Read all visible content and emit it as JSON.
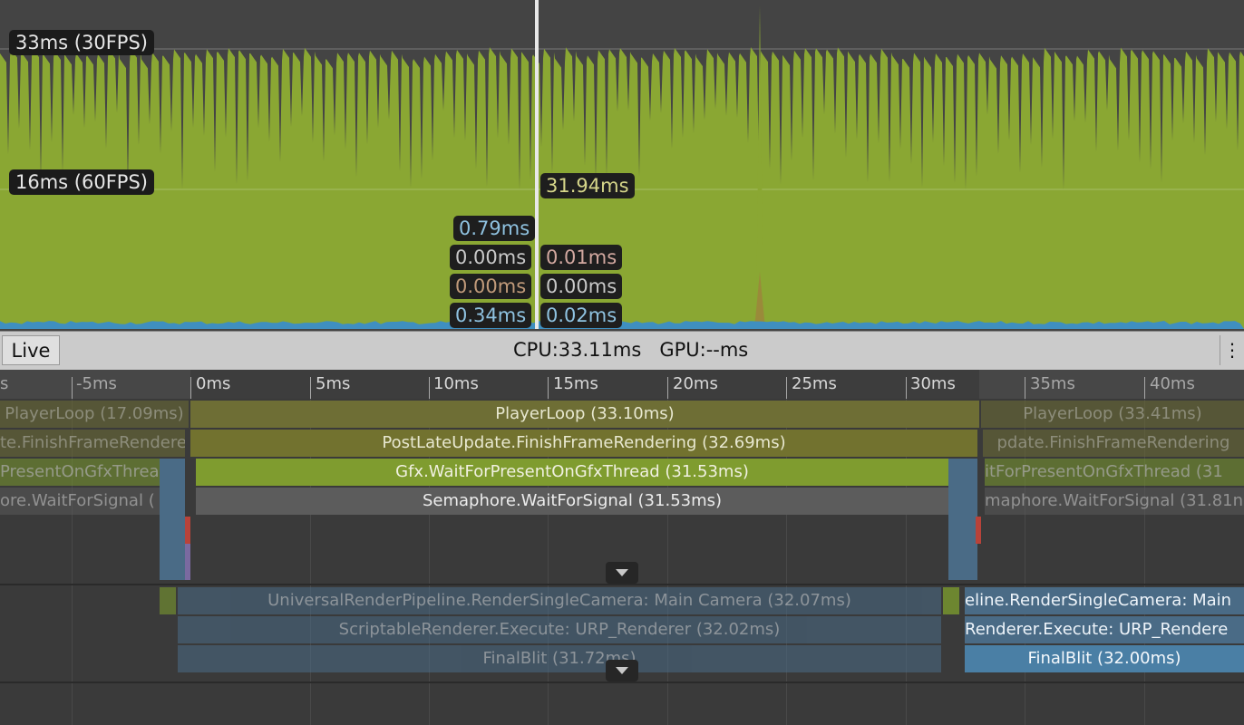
{
  "colors": {
    "cpu_green": "#8aa733",
    "render_blue": "#4a6b86",
    "playerloop_olive": "#6e6e35",
    "semaphore_gray": "#5a5a5a",
    "blue_line": "#3f8fc0"
  },
  "chart": {
    "ref_labels": [
      "33ms (30FPS)",
      "16ms (60FPS)"
    ],
    "selected_value": "31.94ms",
    "breakdown_left": [
      "0.79ms",
      "0.00ms",
      "0.00ms",
      "0.34ms"
    ],
    "breakdown_right": [
      "0.01ms",
      "0.00ms",
      "0.02ms"
    ]
  },
  "status": {
    "live_label": "Live",
    "cpu_gpu": "CPU:33.11ms   GPU:--ms",
    "menu_glyph": "⋮"
  },
  "ruler": {
    "ticks": [
      "s",
      "-5ms",
      "0ms",
      "5ms",
      "10ms",
      "15ms",
      "20ms",
      "25ms",
      "30ms",
      "35ms",
      "40ms"
    ]
  },
  "timeline": {
    "main": [
      {
        "label": "PlayerLoop (17.09ms)"
      },
      {
        "label": "PlayerLoop (33.10ms)"
      },
      {
        "label": "PlayerLoop (33.41ms)"
      },
      {
        "label": "te.FinishFrameRendere"
      },
      {
        "label": "PostLateUpdate.FinishFrameRendering (32.69ms)"
      },
      {
        "label": "pdate.FinishFrameRendering"
      },
      {
        "label": "PresentOnGfxThrea"
      },
      {
        "label": "Gfx.WaitForPresentOnGfxThread (31.53ms)"
      },
      {
        "label": "itForPresentOnGfxThread (31"
      },
      {
        "label": "ore.WaitForSignal ("
      },
      {
        "label": "Semaphore.WaitForSignal (31.53ms)"
      },
      {
        "label": "maphore.WaitForSignal (31.81n"
      }
    ],
    "render": [
      {
        "label": "UniversalRenderPipeline.RenderSingleCamera: Main Camera (32.07ms)"
      },
      {
        "label": "eline.RenderSingleCamera: Main"
      },
      {
        "label": "ScriptableRenderer.Execute: URP_Renderer (32.02ms)"
      },
      {
        "label": "Renderer.Execute: URP_Rendere"
      },
      {
        "label": "FinalBlit (31.72ms)"
      },
      {
        "label": "FinalBlit (32.00ms)"
      }
    ]
  }
}
